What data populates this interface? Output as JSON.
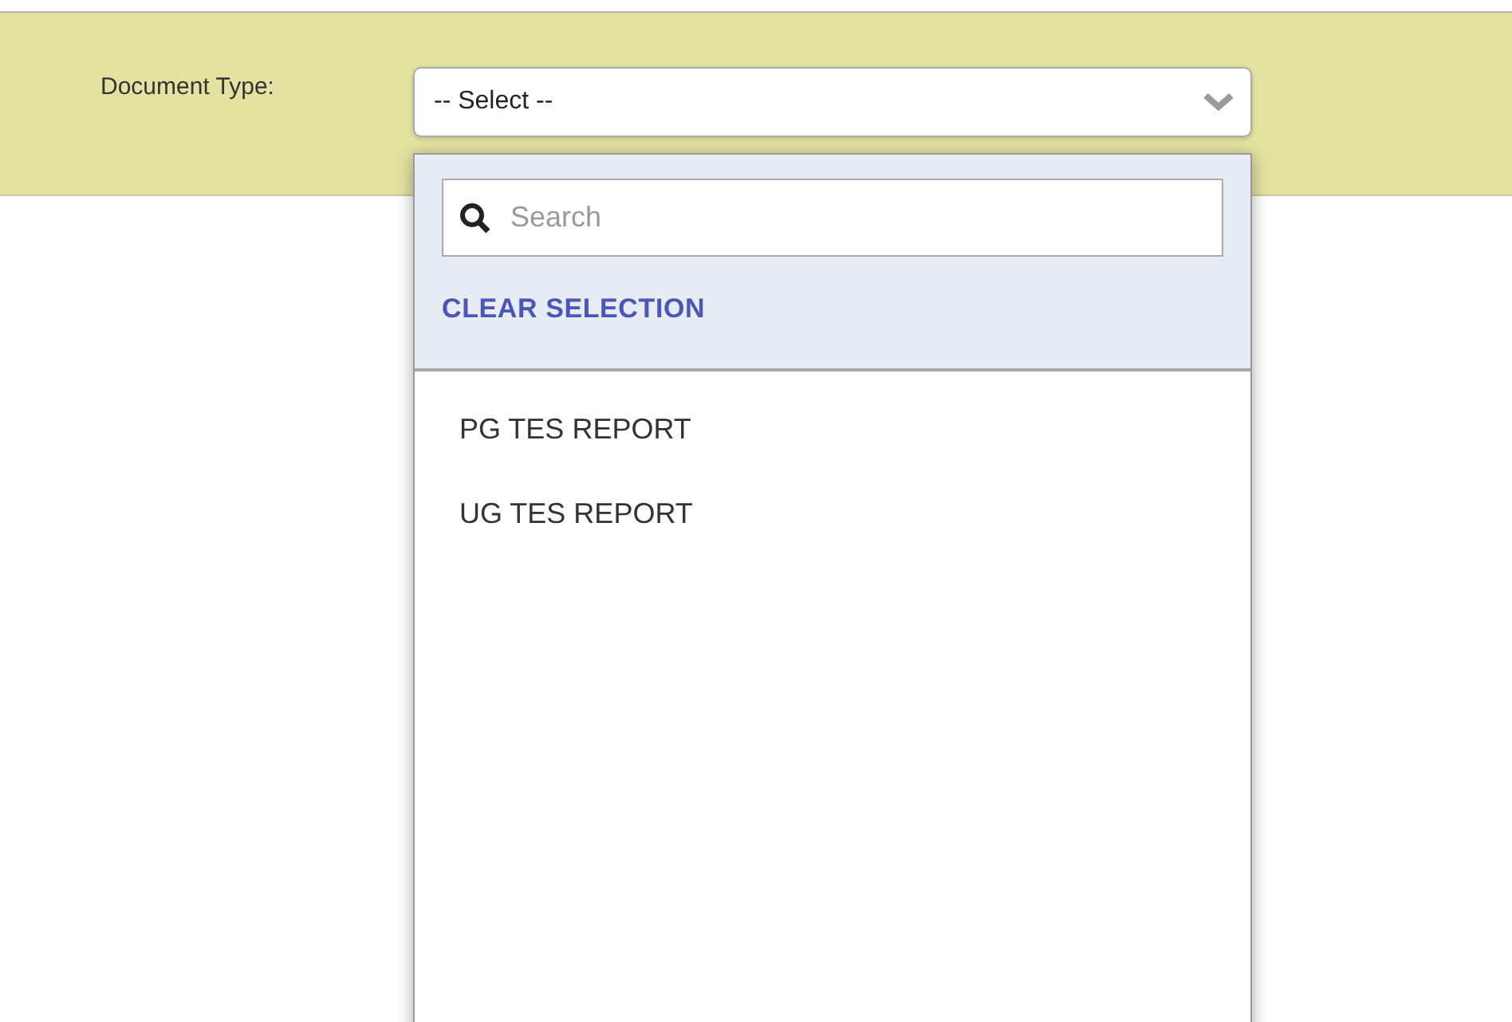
{
  "filter": {
    "label": "Document Type:",
    "select": {
      "value": "-- Select --",
      "expanded": true
    }
  },
  "dropdown": {
    "search": {
      "placeholder": "Search"
    },
    "clear_action": "CLEAR SELECTION",
    "options": [
      {
        "label": "PG TES REPORT",
        "selected": false
      },
      {
        "label": "UG TES REPORT",
        "selected": false
      }
    ]
  }
}
